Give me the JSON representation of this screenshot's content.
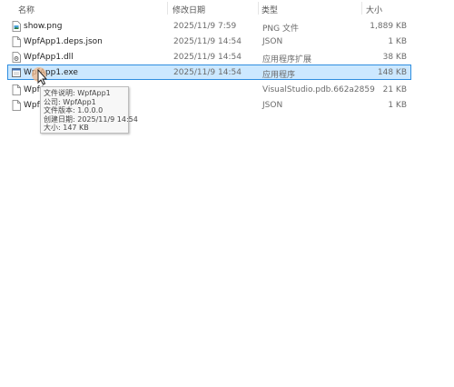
{
  "columns": {
    "name": "名称",
    "date": "修改日期",
    "type": "类型",
    "size": "大小"
  },
  "files": [
    {
      "name": "show.png",
      "date": "2025/11/9 7:59",
      "type": "PNG 文件",
      "size": "1,889 KB",
      "icon": "png-file-icon"
    },
    {
      "name": "WpfApp1.deps.json",
      "date": "2025/11/9 14:54",
      "type": "JSON",
      "size": "1 KB",
      "icon": "json-file-icon"
    },
    {
      "name": "WpfApp1.dll",
      "date": "2025/11/9 14:54",
      "type": "应用程序扩展",
      "size": "38 KB",
      "icon": "dll-file-icon"
    },
    {
      "name": "WpfApp1.exe",
      "date": "2025/11/9 14:54",
      "type": "应用程序",
      "size": "148 KB",
      "icon": "exe-file-icon"
    },
    {
      "name": "WpfA",
      "date": "",
      "type": "VisualStudio.pdb.662a2859",
      "size": "21 KB",
      "icon": "pdb-file-icon"
    },
    {
      "name": "WpfA",
      "date": "",
      "type": "JSON",
      "size": "1 KB",
      "icon": "json-file-icon"
    }
  ],
  "tooltip": {
    "description": "文件说明: WpfApp1",
    "company": "公司: WpfApp1",
    "version": "文件版本: 1.0.0.0",
    "created": "创建日期: 2025/11/9 14:54",
    "size": "大小: 147 KB"
  },
  "colors": {
    "selection_bg": "#cce8ff",
    "selection_border": "#2f8ee0",
    "cursor_highlight": "#f3b98a"
  }
}
